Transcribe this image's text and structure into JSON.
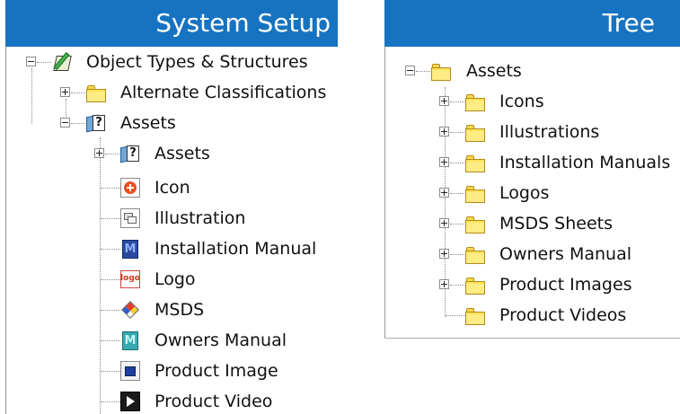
{
  "left_panel": {
    "title": "System Setup",
    "tree": {
      "root": {
        "label": "Object Types & Structures",
        "icon": "object-types-icon",
        "expanded": true
      },
      "alternate": {
        "label": "Alternate Classifications",
        "icon": "folder-icon",
        "expanded": false
      },
      "assets": {
        "label": "Assets",
        "icon": "object-type-icon",
        "expanded": true
      },
      "children": [
        {
          "label": "Assets",
          "icon": "object-type-icon",
          "expandable": true
        },
        {
          "label": "Icon",
          "icon": "icon-asset-icon"
        },
        {
          "label": "Illustration",
          "icon": "illustration-icon"
        },
        {
          "label": "Installation Manual",
          "icon": "manual-icon"
        },
        {
          "label": "Logo",
          "icon": "logo-icon"
        },
        {
          "label": "MSDS",
          "icon": "msds-icon"
        },
        {
          "label": "Owners Manual",
          "icon": "owners-manual-icon"
        },
        {
          "label": "Product Image",
          "icon": "product-image-icon"
        },
        {
          "label": "Product Video",
          "icon": "product-video-icon"
        }
      ]
    }
  },
  "right_panel": {
    "title": "Tree",
    "tree": {
      "root": {
        "label": "Assets",
        "icon": "folder-icon",
        "expanded": true
      },
      "children": [
        {
          "label": "Icons",
          "expandable": true
        },
        {
          "label": "Illustrations",
          "expandable": true
        },
        {
          "label": "Installation Manuals",
          "expandable": true
        },
        {
          "label": "Logos",
          "expandable": true
        },
        {
          "label": "MSDS Sheets",
          "expandable": true
        },
        {
          "label": "Owners Manual",
          "expandable": true
        },
        {
          "label": "Product Images",
          "expandable": true
        },
        {
          "label": "Product Videos",
          "expandable": false
        }
      ]
    }
  },
  "colors": {
    "header_bg": "#1673c1",
    "header_text": "#ffffff",
    "tree_line": "#8a8a8a"
  }
}
